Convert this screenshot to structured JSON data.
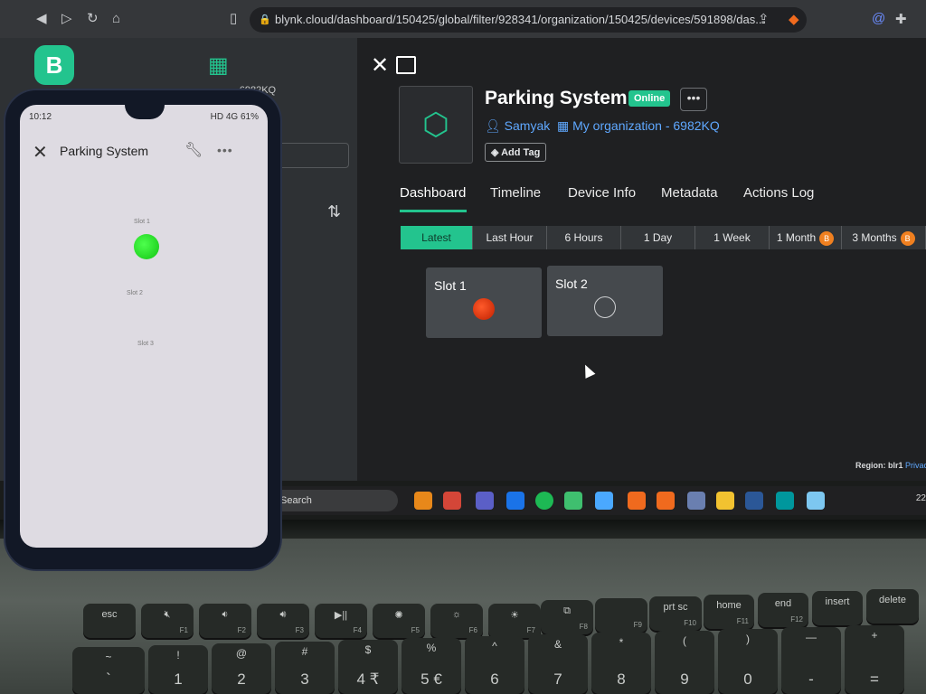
{
  "browser": {
    "url": "blynk.cloud/dashboard/150425/global/filter/928341/organization/150425/devices/591898/das..."
  },
  "left_panel": {
    "org_code": "- 6982KQ"
  },
  "device": {
    "title": "Parking System",
    "status": "Online",
    "owner": "Samyak",
    "organization": "My organization - 6982KQ",
    "add_tag": "Add Tag"
  },
  "tabs": [
    "Dashboard",
    "Timeline",
    "Device Info",
    "Metadata",
    "Actions Log"
  ],
  "active_tab": "Dashboard",
  "time_ranges": [
    "Latest",
    "Last Hour",
    "6 Hours",
    "1 Day",
    "1 Week",
    "1 Month",
    "3 Months"
  ],
  "active_range": "Latest",
  "widgets": [
    {
      "title": "Slot 1",
      "led_state": "on",
      "led_color": "#e83a10"
    },
    {
      "title": "Slot 2",
      "led_state": "off",
      "led_color": "#cfd1d3"
    }
  ],
  "footer": {
    "region_label": "Region: blr1",
    "privacy_link": "Privac"
  },
  "taskbar": {
    "search_label": "Search",
    "clock": "22"
  },
  "phone": {
    "status_time": "10:12",
    "status_right": "HD 4G 61%",
    "title": "Parking System",
    "slots": [
      {
        "label": "Slot 1",
        "led_state": "on",
        "led_color": "#22dd22"
      },
      {
        "label": "Slot 2",
        "led_state": "off"
      },
      {
        "label": "Slot 3",
        "led_state": "off"
      }
    ]
  },
  "keyboard": {
    "row1": [
      "esc",
      "F1",
      "F2",
      "F3",
      "F4",
      "F5",
      "F6",
      "F7",
      "F8",
      "F9",
      "prt sc",
      "home",
      "end",
      "insert",
      "delete"
    ],
    "row1_sub": [
      "",
      "F1",
      "F2",
      "F3",
      "F4",
      "F5",
      "F6",
      "F7",
      "F8",
      "F9",
      "F10",
      "F11",
      "F12",
      "",
      ""
    ],
    "row2_bottom": [
      "`",
      "1",
      "2",
      "3",
      "4 ₹",
      "5 €",
      "6",
      "7",
      "8",
      "9",
      "0",
      "-",
      "="
    ],
    "row2_top": [
      "~",
      "!",
      "@",
      "#",
      "$",
      "%",
      "^",
      "&",
      "*",
      "(",
      ")",
      "—",
      "+"
    ]
  }
}
